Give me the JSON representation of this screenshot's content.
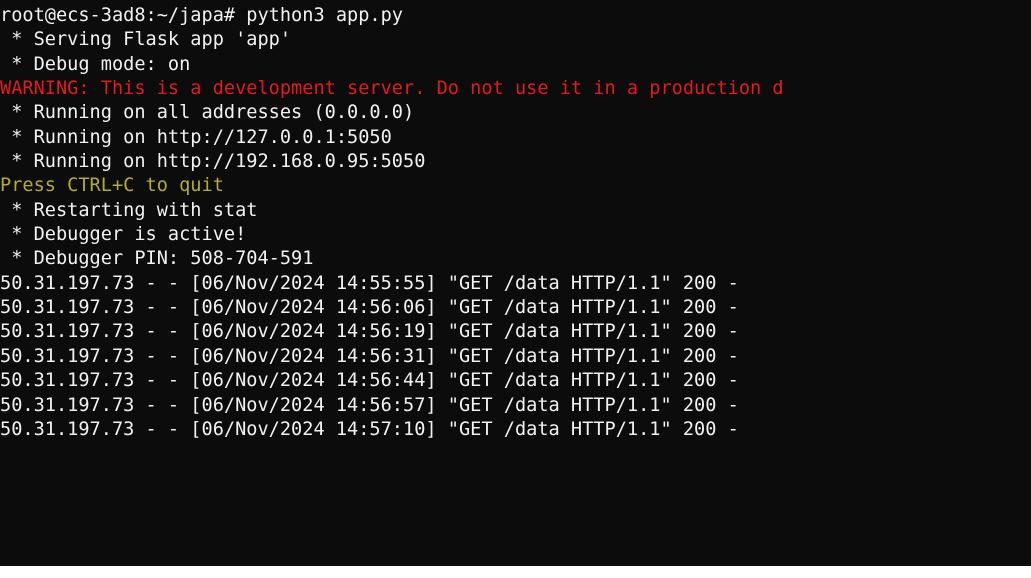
{
  "colors": {
    "background": "#0c0c0c",
    "default_text": "#f2f2f2",
    "warning": "#e31b1b",
    "hint": "#b5ad2a"
  },
  "terminal": {
    "lines": [
      {
        "text": "root@ecs-3ad8:~/japa# python3 app.py",
        "color": "white"
      },
      {
        "text": " * Serving Flask app 'app'",
        "color": "white"
      },
      {
        "text": " * Debug mode: on",
        "color": "white"
      },
      {
        "text": "WARNING: This is a development server. Do not use it in a production d",
        "color": "red"
      },
      {
        "text": " * Running on all addresses (0.0.0.0)",
        "color": "white"
      },
      {
        "text": " * Running on http://127.0.0.1:5050",
        "color": "white"
      },
      {
        "text": " * Running on http://192.168.0.95:5050",
        "color": "white"
      },
      {
        "text": "Press CTRL+C to quit",
        "color": "yellow"
      },
      {
        "text": " * Restarting with stat",
        "color": "white"
      },
      {
        "text": " * Debugger is active!",
        "color": "white"
      },
      {
        "text": " * Debugger PIN: 508-704-591",
        "color": "white"
      },
      {
        "text": "50.31.197.73 - - [06/Nov/2024 14:55:55] \"GET /data HTTP/1.1\" 200 -",
        "color": "white"
      },
      {
        "text": "50.31.197.73 - - [06/Nov/2024 14:56:06] \"GET /data HTTP/1.1\" 200 -",
        "color": "white"
      },
      {
        "text": "50.31.197.73 - - [06/Nov/2024 14:56:19] \"GET /data HTTP/1.1\" 200 -",
        "color": "white"
      },
      {
        "text": "50.31.197.73 - - [06/Nov/2024 14:56:31] \"GET /data HTTP/1.1\" 200 -",
        "color": "white"
      },
      {
        "text": "50.31.197.73 - - [06/Nov/2024 14:56:44] \"GET /data HTTP/1.1\" 200 -",
        "color": "white"
      },
      {
        "text": "50.31.197.73 - - [06/Nov/2024 14:56:57] \"GET /data HTTP/1.1\" 200 -",
        "color": "white"
      },
      {
        "text": "50.31.197.73 - - [06/Nov/2024 14:57:10] \"GET /data HTTP/1.1\" 200 -",
        "color": "white"
      }
    ]
  }
}
